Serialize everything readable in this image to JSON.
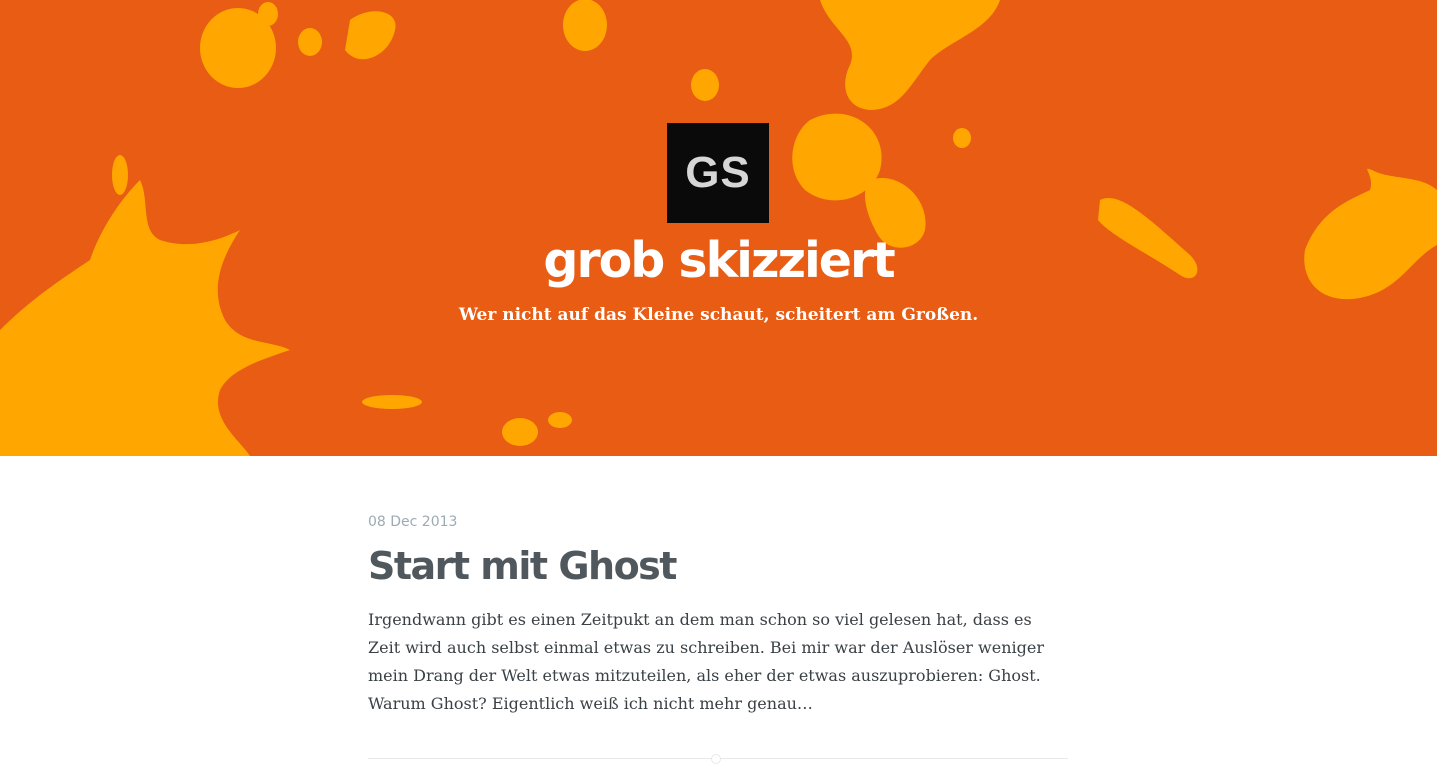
{
  "header": {
    "logo_text": "GS",
    "title": "grob skizziert",
    "tagline": "Wer nicht auf das Kleine schaut, scheitert am Großen.",
    "background_color": "#e85c14",
    "splash_color": "#ffa600"
  },
  "posts": [
    {
      "date": "08 Dec 2013",
      "title": "Start mit Ghost",
      "excerpt": "Irgendwann gibt es einen Zeitpukt an dem man schon so viel gelesen hat, dass es Zeit wird auch selbst einmal etwas zu schreiben. Bei mir war der Auslöser weniger mein Drang der Welt etwas mitzuteilen, als eher der etwas auszuprobieren: Ghost. Warum Ghost? Eigentlich weiß ich nicht mehr genau…"
    }
  ]
}
